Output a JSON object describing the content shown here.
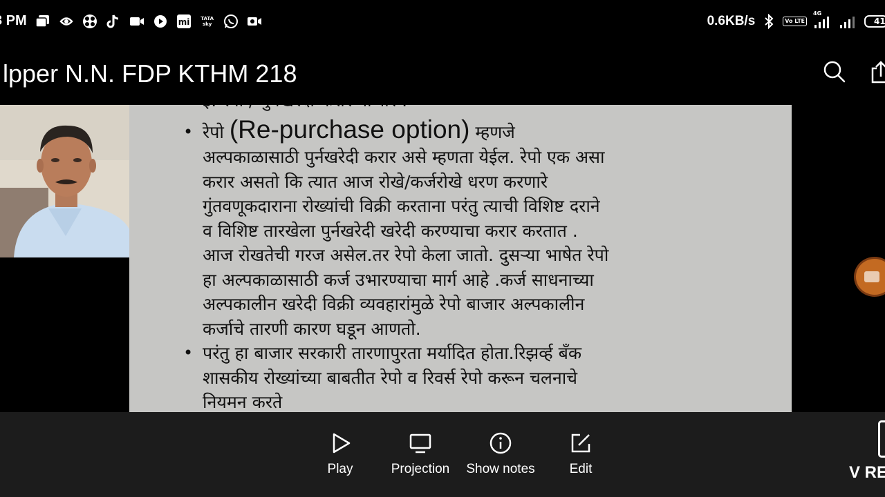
{
  "status_bar": {
    "time": "3 PM",
    "net_speed": "0.6KB/s",
    "volte": "Vo LTE",
    "network_type": "4G",
    "battery": "41",
    "icons": [
      "gallery-icon",
      "whirlpool-icon",
      "fan-icon",
      "tiktok-icon",
      "video-camera-icon",
      "play-circle-icon",
      "mi-icon",
      "tata-sky-icon",
      "whatsapp-icon",
      "screen-recorder-icon",
      "bluetooth-icon",
      "signal-icon",
      "signal-icon",
      "battery-icon"
    ],
    "tata_label_top": "TATA",
    "tata_label_bottom": "sky",
    "mi_label": "mi"
  },
  "title_bar": {
    "title": "lpper N.N. FDP KTHM 218"
  },
  "slide": {
    "partial_top_line": "इ. रेपो / पुर्नखरेदी करार बाजार :",
    "bullet_char": "•",
    "bullet1": {
      "prefix": "रेपो ",
      "english": "(Re-purchase option)",
      "suffix": " म्हणजे",
      "lines": [
        "अल्पकाळासाठी  पुर्नखरेदी करार असे म्हणता येईल. रेपो एक असा",
        "करार असतो कि त्यात आज रोखे/कर्जरोखे धरण करणारे",
        "गुंतवणूकदाराना रोख्यांची विक्री करताना परंतु त्याची  विशिष्ट दराने",
        "व विशिष्ट तारखेला पुर्नखरेदी खरेदी  करण्याचा करार करतात .",
        "आज रोखतेची गरज असेल.तर रेपो केला जातो. दुसऱ्या भाषेत रेपो",
        "हा अल्पकाळासाठी कर्ज उभारण्याचा मार्ग आहे .कर्ज साधनाच्या",
        "अल्पकालीन खरेदी विक्री व्यवहारांमुळे  रेपो बाजार अल्पकालीन",
        "कर्जाचे  तारणी कारण घडून  आणतो."
      ]
    },
    "bullet2": {
      "lines": [
        "परंतु हा बाजार सरकारी  तारणापुरता मर्यादित होता.रिझर्व्ह बँक",
        "शासकीय रोख्यांच्या बाबतीत रेपो व रिवर्स  रेपो करून चलनाचे",
        "नियमन करते"
      ]
    }
  },
  "toolbar": {
    "play_label": "Play",
    "projection_label": "Projection",
    "show_notes_label": "Show notes",
    "edit_label": "Edit",
    "corner_text": "V RE"
  },
  "colors": {
    "background": "#000000",
    "slide_background": "#c6c6c4",
    "toolbar_background": "#1c1c1c",
    "floating_button": "#c36a22"
  }
}
